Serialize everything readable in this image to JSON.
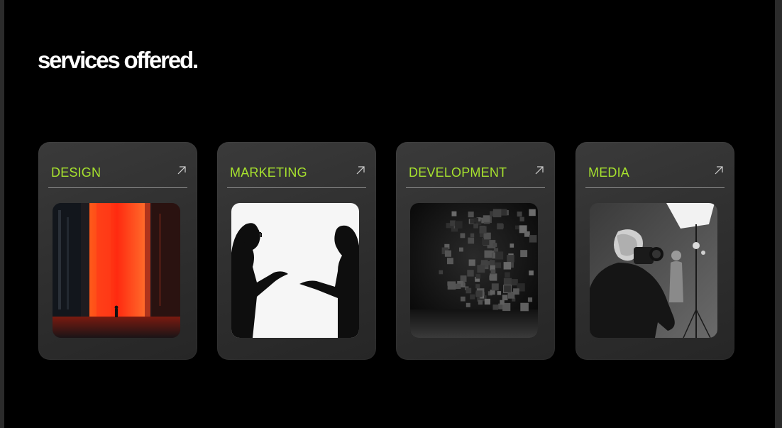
{
  "page": {
    "title": "services offered."
  },
  "cards": [
    {
      "label": "DESIGN",
      "image": "red-corridor-figure-image"
    },
    {
      "label": "MARKETING",
      "image": "two-silhouettes-talking-image"
    },
    {
      "label": "DEVELOPMENT",
      "image": "pixel-cubes-dissolving-image"
    },
    {
      "label": "MEDIA",
      "image": "photographer-studio-image"
    }
  ],
  "colors": {
    "accent": "#a7e22e",
    "background": "#000000",
    "card": "#333333"
  }
}
